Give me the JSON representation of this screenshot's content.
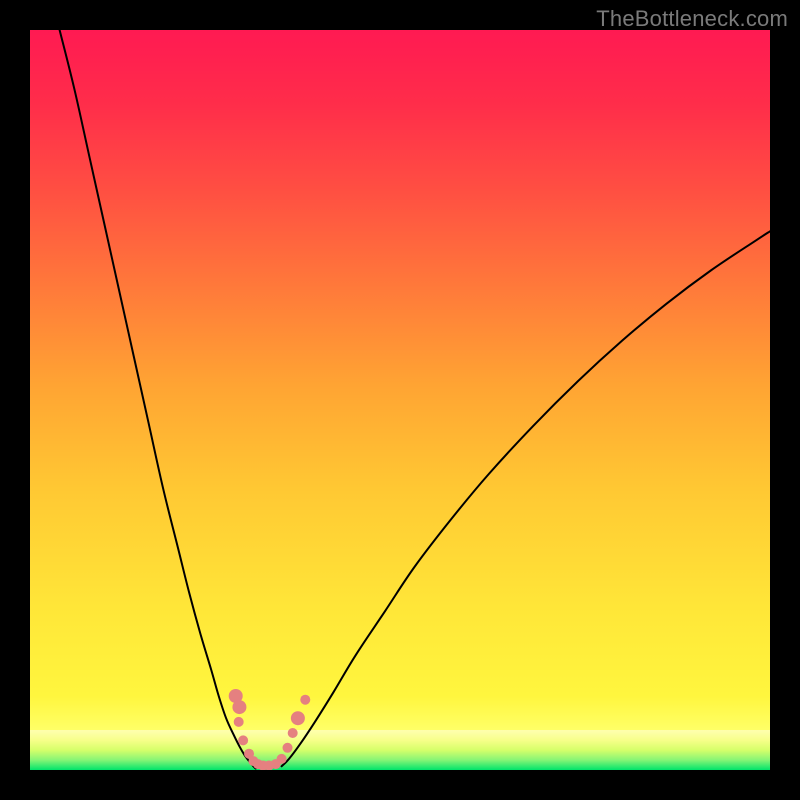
{
  "watermark": "TheBottleneck.com",
  "chart_data": {
    "type": "line",
    "title": "",
    "xlabel": "",
    "ylabel": "",
    "xlim": [
      0,
      100
    ],
    "ylim": [
      0,
      100
    ],
    "grid": false,
    "legend": false,
    "background_gradient": {
      "top_color": "#ff1a52",
      "mid_color": "#ffe638",
      "bottom_color": "#00e46b"
    },
    "green_band": {
      "top_fraction": 0.946,
      "colors": [
        "#ffffb0",
        "#f7ff8a",
        "#d6ff6a",
        "#86f576",
        "#00e46b"
      ]
    },
    "series": [
      {
        "name": "curve-left",
        "stroke": "#000000",
        "x": [
          4.0,
          6.0,
          8.0,
          10.0,
          12.0,
          14.0,
          16.0,
          18.0,
          20.0,
          21.5,
          23.0,
          24.5,
          25.5,
          26.5,
          27.5,
          28.3,
          29.0,
          29.6,
          30.1,
          30.5
        ],
        "y": [
          100.0,
          92.0,
          83.0,
          74.0,
          65.0,
          56.0,
          47.0,
          38.0,
          30.0,
          24.0,
          18.5,
          13.5,
          10.0,
          7.0,
          4.8,
          3.2,
          2.0,
          1.2,
          0.6,
          0.2
        ]
      },
      {
        "name": "curve-right",
        "stroke": "#000000",
        "x": [
          34.0,
          35.0,
          36.5,
          38.5,
          41.0,
          44.0,
          48.0,
          52.0,
          57.0,
          62.0,
          68.0,
          74.0,
          80.0,
          86.0,
          92.0,
          98.0,
          100.0
        ],
        "y": [
          0.5,
          1.5,
          3.5,
          6.5,
          10.5,
          15.5,
          21.5,
          27.5,
          34.0,
          40.0,
          46.5,
          52.5,
          58.0,
          63.0,
          67.5,
          71.5,
          72.8
        ]
      }
    ],
    "markers": {
      "name": "dotted-dip",
      "color": "#e58080",
      "radius_small": 5,
      "radius_large": 7,
      "points": [
        {
          "x": 27.8,
          "y": 10.0,
          "r": "large"
        },
        {
          "x": 28.3,
          "y": 8.5,
          "r": "large"
        },
        {
          "x": 28.2,
          "y": 6.5,
          "r": "small"
        },
        {
          "x": 28.8,
          "y": 4.0,
          "r": "small"
        },
        {
          "x": 29.6,
          "y": 2.2,
          "r": "small"
        },
        {
          "x": 30.2,
          "y": 1.2,
          "r": "small"
        },
        {
          "x": 30.8,
          "y": 0.8,
          "r": "small"
        },
        {
          "x": 31.5,
          "y": 0.6,
          "r": "small"
        },
        {
          "x": 32.3,
          "y": 0.6,
          "r": "small"
        },
        {
          "x": 33.2,
          "y": 0.8,
          "r": "small"
        },
        {
          "x": 34.0,
          "y": 1.5,
          "r": "small"
        },
        {
          "x": 34.8,
          "y": 3.0,
          "r": "small"
        },
        {
          "x": 35.5,
          "y": 5.0,
          "r": "small"
        },
        {
          "x": 36.2,
          "y": 7.0,
          "r": "large"
        },
        {
          "x": 37.2,
          "y": 9.5,
          "r": "small"
        }
      ]
    }
  }
}
